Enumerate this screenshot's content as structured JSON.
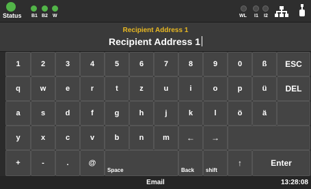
{
  "status": {
    "label": "Status",
    "indicators": [
      {
        "label": "B1",
        "color": "#52b548"
      },
      {
        "label": "B2",
        "color": "#52b548"
      },
      {
        "label": "W",
        "color": "#52b548"
      }
    ],
    "right_indicators": [
      {
        "label": "WL",
        "color": "#4a4a4a"
      },
      {
        "label": "I1",
        "color": "#4a4a4a"
      },
      {
        "label": "I2",
        "color": "#4a4a4a"
      }
    ],
    "icons": [
      "network-icon",
      "usb-icon"
    ]
  },
  "input": {
    "label": "Recipient Address 1",
    "value": "Recipient Address 1"
  },
  "keyboard": {
    "row1": [
      "1",
      "2",
      "3",
      "4",
      "5",
      "6",
      "7",
      "8",
      "9",
      "0",
      "ß",
      "ESC"
    ],
    "row2": [
      "q",
      "w",
      "e",
      "r",
      "t",
      "z",
      "u",
      "i",
      "o",
      "p",
      "ü",
      "DEL"
    ],
    "row3": [
      "a",
      "s",
      "d",
      "f",
      "g",
      "h",
      "j",
      "k",
      "l",
      "ö",
      "ä"
    ],
    "row4": [
      "y",
      "x",
      "c",
      "v",
      "b",
      "n",
      "m",
      "←",
      "→"
    ],
    "row5": {
      "plus": "+",
      "minus": "-",
      "dot": ".",
      "at": "@",
      "space": "Space",
      "back": "Back",
      "shift": "shift",
      "up": "↑",
      "enter": "Enter"
    }
  },
  "footer": {
    "title": "Email",
    "time": "13:28:08"
  },
  "colors": {
    "accent": "#e8b822",
    "green": "#52b548",
    "key_bg": "#444444"
  }
}
